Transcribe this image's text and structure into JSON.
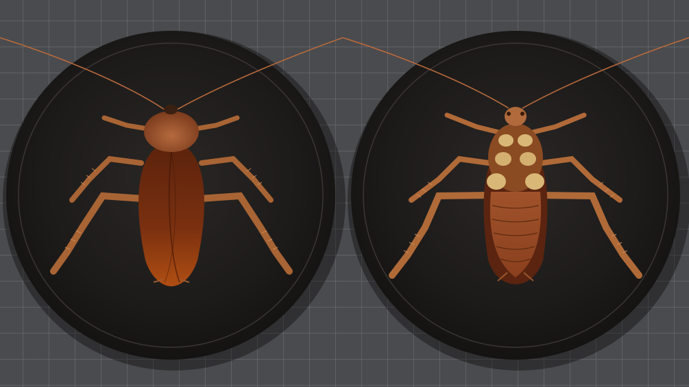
{
  "scene": {
    "background_color": "#4a4b4e",
    "grid_color": "#6d6e72",
    "plaque_color": "#1c1a19",
    "body_color": "#8a3f1a",
    "leg_color": "#a86434",
    "underside_pad_color": "#d9b877"
  },
  "specimens": [
    {
      "view": "dorsal",
      "icon": "cockroach-dorsal-icon"
    },
    {
      "view": "ventral",
      "icon": "cockroach-ventral-icon"
    }
  ]
}
